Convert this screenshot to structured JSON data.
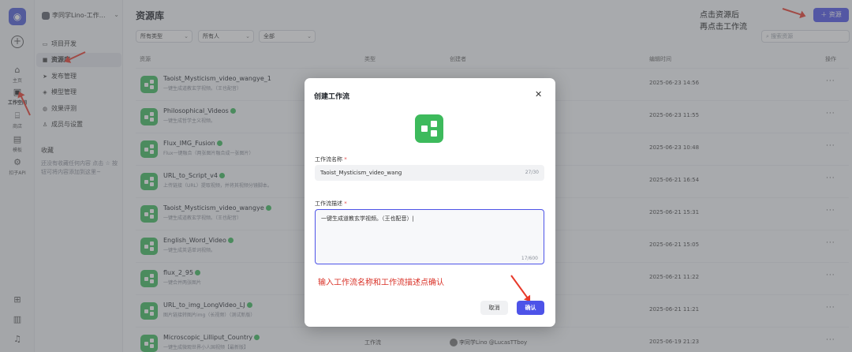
{
  "rail": {
    "items": [
      {
        "label": "主页",
        "icon": "home-icon"
      },
      {
        "label": "工作空间",
        "icon": "workspace-icon"
      },
      {
        "label": "商店",
        "icon": "store-icon"
      },
      {
        "label": "模板",
        "icon": "template-icon"
      },
      {
        "label": "扣子API",
        "icon": "api-icon"
      }
    ]
  },
  "sidebar": {
    "workspace_name": "李同学Lino-工作…",
    "items": [
      {
        "label": "项目开发"
      },
      {
        "label": "资源库"
      },
      {
        "label": "发布管理"
      },
      {
        "label": "模型管理"
      },
      {
        "label": "效果评测"
      },
      {
        "label": "成员与设置"
      }
    ],
    "favorites_title": "收藏",
    "favorites_empty": "还没有收藏任何内容 点击 ☆ 按钮可将内容添加到这里~"
  },
  "main": {
    "title": "资源库",
    "add_button": "＋ 资源",
    "annotation_top": "点击资源后\n再点击工作流",
    "filters": [
      "所有类型",
      "所有人",
      "全部"
    ],
    "search_placeholder": "搜索资源",
    "columns": [
      "资源",
      "类型",
      "创建者",
      "编辑时间",
      "操作"
    ],
    "rows": [
      {
        "name": "Taoist_Mysticism_video_wangye_1",
        "desc": "一键生成道教玄学视频。（王也配音）",
        "type": "",
        "creator": "",
        "time": "2025-06-23 14:56",
        "check": false
      },
      {
        "name": "Philosophical_Videos",
        "desc": "一键生成哲学主义视频。",
        "type": "",
        "creator": "",
        "time": "2025-06-23 11:55",
        "check": true
      },
      {
        "name": "Flux_IMG_Fusion",
        "desc": "Flux一键融合（两张图片融合成一张图片）",
        "type": "",
        "creator": "",
        "time": "2025-06-23 10:48",
        "check": true
      },
      {
        "name": "URL_to_Script_v4",
        "desc": "上传链接（URL）提取视频，并将其视频分镜脚本。",
        "type": "",
        "creator": "",
        "time": "2025-06-21 16:54",
        "check": true
      },
      {
        "name": "Taoist_Mysticism_video_wangye",
        "desc": "一键生成道教玄学视频。（王也配音）",
        "type": "",
        "creator": "",
        "time": "2025-06-21 15:31",
        "check": true
      },
      {
        "name": "English_Word_Video",
        "desc": "一键生成英语单词视频。",
        "type": "",
        "creator": "",
        "time": "2025-06-21 15:05",
        "check": true
      },
      {
        "name": "flux_2_95",
        "desc": "一键合并两张图片",
        "type": "",
        "creator": "",
        "time": "2025-06-21 11:22",
        "check": true
      },
      {
        "name": "URL_to_img_LongVideo_LJ",
        "desc": "图片链接转图片img（长视频）（测试新版）",
        "type": "",
        "creator": "",
        "time": "2025-06-21 11:21",
        "check": true
      },
      {
        "name": "Microscopic_Lilliput_Country",
        "desc": "一键生成微观世界小人国视频【最新版】",
        "type": "工作流",
        "creator": "李同学Lino @LucasTTboy",
        "time": "2025-06-19 21:23",
        "check": true
      }
    ],
    "more": "···"
  },
  "modal": {
    "title": "创建工作流",
    "close": "✕",
    "name_label": "工作流名称",
    "name_value": "Taoist_Mysticism_video_wang",
    "name_count": "27/30",
    "desc_label": "工作流描述",
    "desc_value": "一键生成道教玄学视频。（王也配音）",
    "desc_count": "17/600",
    "required_mark": "*",
    "hint": "输入工作流名称和工作流描述点确认",
    "cancel": "取消",
    "confirm": "确认"
  },
  "colors": {
    "accent": "#4d53e8",
    "workflow_green": "#3dba5c",
    "annotation_red": "#e8392a"
  }
}
